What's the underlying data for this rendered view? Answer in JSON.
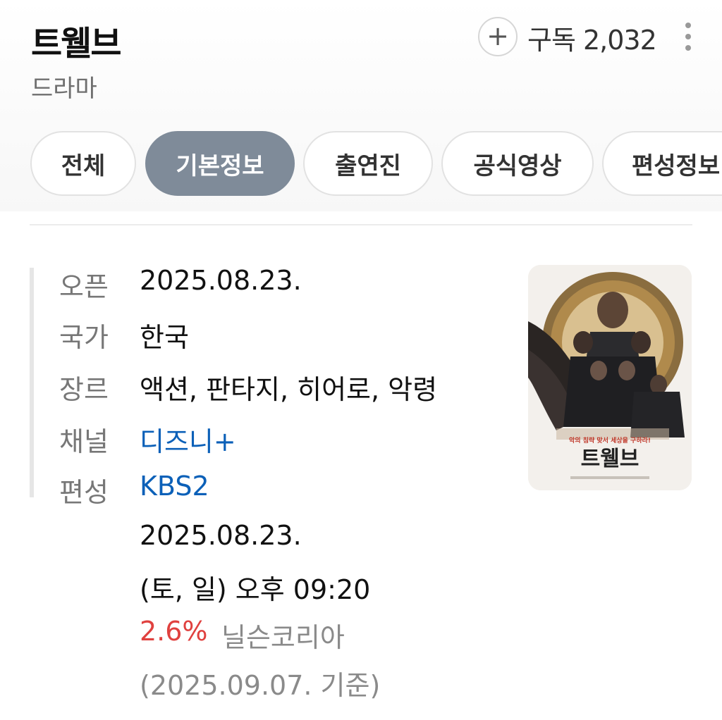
{
  "header": {
    "title": "트웰브",
    "subtitle": "드라마",
    "subscribe_label": "구독 2,032"
  },
  "tabs": [
    {
      "label": "전체",
      "active": false
    },
    {
      "label": "기본정보",
      "active": true
    },
    {
      "label": "출연진",
      "active": false
    },
    {
      "label": "공식영상",
      "active": false
    },
    {
      "label": "편성정보",
      "active": false
    }
  ],
  "info": {
    "open_label": "오픈",
    "open_value": "2025.08.23.",
    "country_label": "국가",
    "country_value": "한국",
    "genre_label": "장르",
    "genre_value": "액션, 판타지, 히어로, 악령",
    "channel_label": "채널",
    "channel_value": "디즈니+",
    "schedule_label": "편성",
    "schedule_channel": "KBS2",
    "schedule_date": "2025.08.23.",
    "schedule_time": "(토, 일) 오후 09:20",
    "rating_value": "2.6%",
    "rating_source": "닐슨코리아",
    "rating_basis": "(2025.09.07. 기준)"
  },
  "poster": {
    "title": "트웰브",
    "tagline": "악의 침략 맞서 세상을 구하라!"
  },
  "colors": {
    "active_tab": "#7f8b99",
    "link": "#0b60b8",
    "rating": "#e0413f"
  },
  "icons": {
    "subscribe": "plus-icon",
    "more": "more-vertical-icon"
  }
}
